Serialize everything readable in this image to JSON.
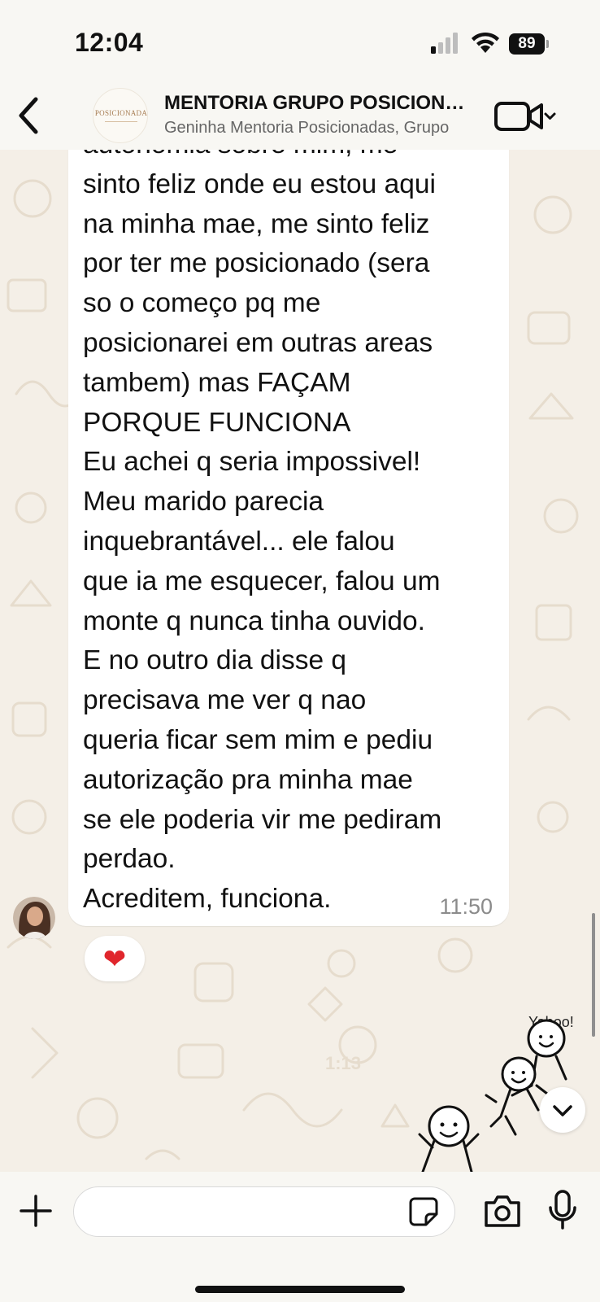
{
  "status_bar": {
    "time": "12:04",
    "battery": "89"
  },
  "header": {
    "title": "MENTORIA GRUPO POSICIONADAS",
    "subtitle": "Geninha Mentoria Posicionadas, Grupo",
    "avatar_logo_text": "POSICIONADA"
  },
  "message": {
    "text": "autonomia sobre mim, me\nsinto feliz onde eu estou aqui\nna minha mae, me sinto feliz\npor ter me posicionado (sera\nso o começo pq me\nposicionarei em outras areas\ntambem) mas FAÇAM\nPORQUE FUNCIONA\nEu achei q seria impossivel!\nMeu marido parecia\ninquebrantável... ele falou\nque ia me esquecer, falou um\nmonte q nunca tinha ouvido.\nE no outro dia disse q\nprecisava me ver q nao\nqueria ficar sem mim e pediu\nautorização pra minha mae\nse ele poderia vir me pediram\nperdao.\nAcreditem, funciona.",
    "time": "11:50",
    "reaction": "❤"
  },
  "sticker": {
    "caption": "Yahoo!"
  },
  "input": {
    "value": "",
    "placeholder": ""
  },
  "icons": {
    "back": "chevron-left-icon",
    "video_call": "video-camera-icon",
    "dropdown": "chevron-down-icon",
    "plus": "plus-icon",
    "sticker": "sticker-icon",
    "camera": "camera-icon",
    "microphone": "microphone-icon",
    "scroll_down": "chevron-down-icon"
  },
  "colors": {
    "wallpaper": "#f4efe7",
    "bubble": "#ffffff",
    "bar_background": "#f8f7f3",
    "reaction_heart": "#e0262c",
    "time_text": "#8b8b8b"
  }
}
